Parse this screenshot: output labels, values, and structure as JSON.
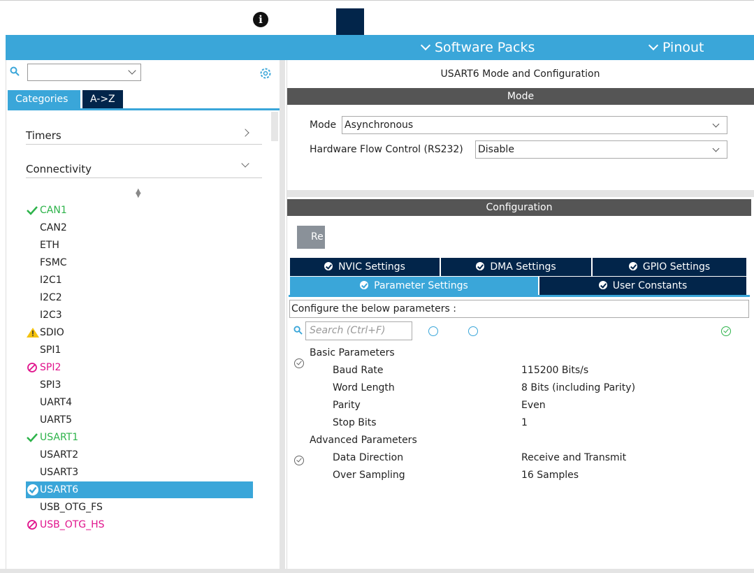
{
  "header": {
    "software_packs": "Software Packs",
    "pinout": "Pinout"
  },
  "left": {
    "tabs": [
      "Categories",
      "A->Z"
    ],
    "categories": [
      {
        "label": "Timers"
      },
      {
        "label": "Connectivity"
      }
    ],
    "items": [
      {
        "label": "CAN1",
        "status": "ok"
      },
      {
        "label": "CAN2",
        "status": "none"
      },
      {
        "label": "ETH",
        "status": "none"
      },
      {
        "label": "FSMC",
        "status": "none"
      },
      {
        "label": "I2C1",
        "status": "none"
      },
      {
        "label": "I2C2",
        "status": "none"
      },
      {
        "label": "I2C3",
        "status": "none"
      },
      {
        "label": "SDIO",
        "status": "warning"
      },
      {
        "label": "SPI1",
        "status": "none"
      },
      {
        "label": "SPI2",
        "status": "blocked"
      },
      {
        "label": "SPI3",
        "status": "none"
      },
      {
        "label": "UART4",
        "status": "none"
      },
      {
        "label": "UART5",
        "status": "none"
      },
      {
        "label": "USART1",
        "status": "ok"
      },
      {
        "label": "USART2",
        "status": "none"
      },
      {
        "label": "USART3",
        "status": "none"
      },
      {
        "label": "USART6",
        "status": "selected"
      },
      {
        "label": "USB_OTG_FS",
        "status": "none"
      },
      {
        "label": "USB_OTG_HS",
        "status": "blocked"
      }
    ]
  },
  "right": {
    "title": "USART6 Mode and Configuration",
    "mode_header": "Mode",
    "mode_label": "Mode",
    "mode_value": "Asynchronous",
    "flow_label": "Hardware Flow Control (RS232)",
    "flow_value": "Disable",
    "config_header": "Configuration",
    "reset_label": "Re",
    "tabs_row1": [
      "NVIC Settings",
      "DMA Settings",
      "GPIO Settings"
    ],
    "tabs_row2": [
      "Parameter Settings",
      "User Constants"
    ],
    "configure_text": "Configure the below parameters :",
    "search_placeholder": "Search (Ctrl+F)",
    "groups": [
      {
        "name": "Basic Parameters",
        "params": [
          {
            "name": "Baud Rate",
            "value": "115200 Bits/s"
          },
          {
            "name": "Word Length",
            "value": "8 Bits (including Parity)"
          },
          {
            "name": "Parity",
            "value": "Even"
          },
          {
            "name": "Stop Bits",
            "value": "1"
          }
        ]
      },
      {
        "name": "Advanced Parameters",
        "params": [
          {
            "name": "Data Direction",
            "value": "Receive and Transmit"
          },
          {
            "name": "Over Sampling",
            "value": "16 Samples"
          }
        ]
      }
    ]
  },
  "colors": {
    "accent": "#3aa6d9",
    "navy": "#02254a",
    "ok": "#2db34a",
    "blocked": "#e0138c",
    "warning": "#f4c20d"
  }
}
